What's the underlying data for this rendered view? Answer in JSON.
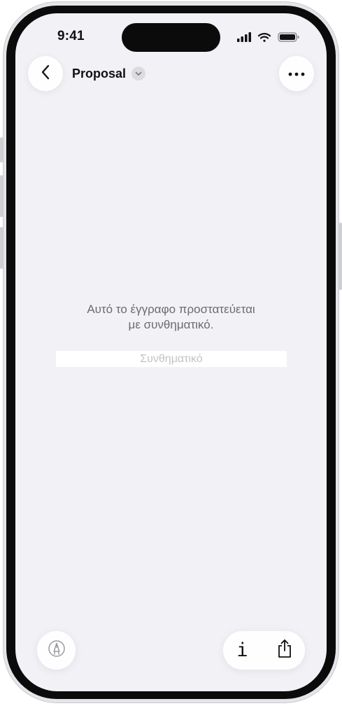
{
  "status_bar": {
    "time": "9:41",
    "icons": [
      "cellular-signal-icon",
      "wifi-icon",
      "battery-icon"
    ]
  },
  "nav": {
    "back_icon": "chevron-left-icon",
    "title": "Proposal",
    "title_menu_icon": "chevron-down-icon",
    "more_icon": "ellipsis-icon"
  },
  "content": {
    "message_line1": "Αυτό το έγγραφο προστατεύεται",
    "message_line2": "με συνθηματικό.",
    "password_placeholder": "Συνθηματικό"
  },
  "toolbar": {
    "markup_icon": "markup-pen-icon",
    "info_label": "i",
    "share_icon": "share-icon"
  },
  "colors": {
    "screen_background": "#f2f1f6",
    "message_text": "#6b6b70",
    "placeholder_text": "#c3c3c7"
  }
}
